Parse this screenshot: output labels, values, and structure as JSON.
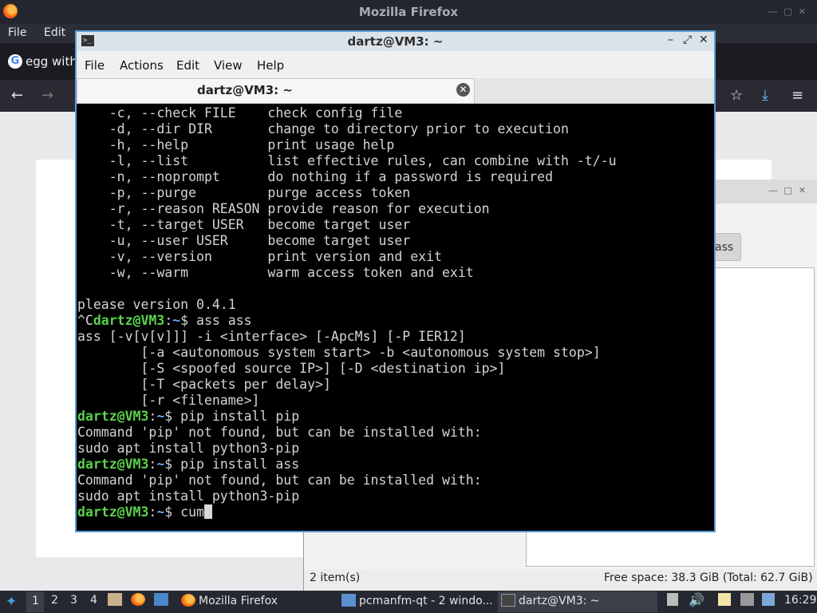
{
  "firefox": {
    "window_title": "Mozilla Firefox",
    "menu": [
      "File",
      "Edit"
    ],
    "tab_title": "egg with",
    "tab_favicon": "G"
  },
  "pcmanfm": {
    "button_label": "ass",
    "status_items": "2 item(s)",
    "status_free": "Free space: 38.3 GiB (Total: 62.7 GiB)"
  },
  "terminal": {
    "window_title": "dartz@VM3: ~",
    "menu": [
      "File",
      "Actions",
      "Edit",
      "View",
      "Help"
    ],
    "tab_title": "dartz@VM3: ~",
    "lines": [
      {
        "text": "    -c, --check FILE    check config file"
      },
      {
        "text": "    -d, --dir DIR       change to directory prior to execution"
      },
      {
        "text": "    -h, --help          print usage help"
      },
      {
        "text": "    -l, --list          list effective rules, can combine with -t/-u"
      },
      {
        "text": "    -n, --noprompt      do nothing if a password is required"
      },
      {
        "text": "    -p, --purge         purge access token"
      },
      {
        "text": "    -r, --reason REASON provide reason for execution"
      },
      {
        "text": "    -t, --target USER   become target user"
      },
      {
        "text": "    -u, --user USER     become target user"
      },
      {
        "text": "    -v, --version       print version and exit"
      },
      {
        "text": "    -w, --warm          warm access token and exit"
      },
      {
        "text": ""
      },
      {
        "text": "please version 0.4.1"
      },
      {
        "pre": "^C",
        "user": "dartz@VM3",
        "path": "~",
        "cmd": "$ ass ass"
      },
      {
        "text": "ass [-v[v[v]]] -i <interface> [-ApcMs] [-P IER12]"
      },
      {
        "text": "        [-a <autonomous system start> -b <autonomous system stop>]"
      },
      {
        "text": "        [-S <spoofed source IP>] [-D <destination ip>]"
      },
      {
        "text": "        [-T <packets per delay>]"
      },
      {
        "text": "        [-r <filename>]"
      },
      {
        "user": "dartz@VM3",
        "path": "~",
        "cmd": "$ pip install pip"
      },
      {
        "text": "Command 'pip' not found, but can be installed with:"
      },
      {
        "text": "sudo apt install python3-pip"
      },
      {
        "user": "dartz@VM3",
        "path": "~",
        "cmd": "$ pip install ass"
      },
      {
        "text": "Command 'pip' not found, but can be installed with:"
      },
      {
        "text": "sudo apt install python3-pip"
      },
      {
        "user": "dartz@VM3",
        "path": "~",
        "cmd": "$ cum",
        "cursor": true
      }
    ]
  },
  "taskbar": {
    "workspaces": [
      "1",
      "2",
      "3",
      "4"
    ],
    "tasks": [
      {
        "label": "Mozilla Firefox",
        "icon": "firefox-icon"
      },
      {
        "label": "pcmanfm-qt - 2 windo...",
        "icon": "folder-icon"
      },
      {
        "label": "dartz@VM3: ~",
        "icon": "terminal-icon"
      }
    ],
    "clock": "16:29"
  },
  "colors": {
    "prompt_user": "#5ad24b",
    "prompt_path": "#6aa8f0",
    "terminal_border": "#5e9dd5"
  }
}
